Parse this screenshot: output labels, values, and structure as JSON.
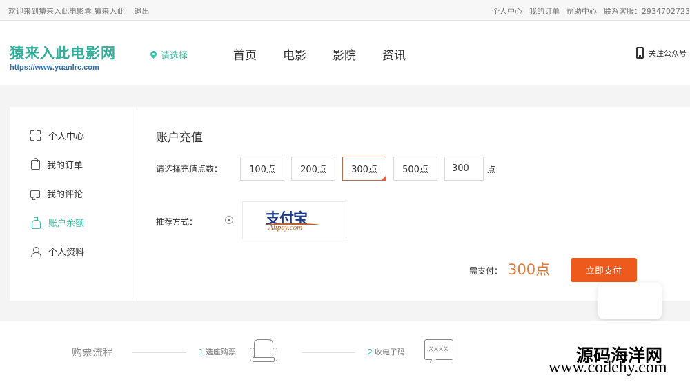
{
  "topbar": {
    "welcome": "欢迎来到猿来入此电影票 猿来入此",
    "logout": "退出",
    "links": [
      "个人中心",
      "我的订单",
      "帮助中心"
    ],
    "service": "联系客服：2934702723"
  },
  "header": {
    "logo_name": "猿来入此电影网",
    "logo_url": "https://www.yuanlrc.com",
    "city": "请选择",
    "nav": [
      "首页",
      "电影",
      "影院",
      "资讯"
    ],
    "wechat": "关注公众号"
  },
  "sidebar": {
    "items": [
      {
        "label": "个人中心",
        "icon": "grid-icon"
      },
      {
        "label": "我的订单",
        "icon": "bag-icon"
      },
      {
        "label": "我的评论",
        "icon": "comment-icon"
      },
      {
        "label": "账户余额",
        "icon": "balance-icon",
        "active": true
      },
      {
        "label": "个人资料",
        "icon": "user-icon"
      }
    ]
  },
  "recharge": {
    "title": "账户充值",
    "amount_label": "请选择充值点数：",
    "options": [
      "100点",
      "200点",
      "300点",
      "500点"
    ],
    "selected": "300点",
    "custom_value": "300",
    "unit": "点",
    "method_label": "推荐方式：",
    "alipay_cn": "支付宝",
    "alipay_en": "Alipay.com",
    "need_label": "需支付：",
    "need_value": "300点",
    "pay_button": "立即支付"
  },
  "process": {
    "title": "购票流程",
    "steps": [
      {
        "num": "1",
        "label": "选座购票"
      },
      {
        "num": "2",
        "label": "收电子码"
      }
    ],
    "code_text": "XXXX"
  },
  "watermark": {
    "line1": "源码海洋网",
    "line2": "www.codehy.com"
  },
  "colors": {
    "accent": "#3bbfa5",
    "pay": "#ee5a1c",
    "price": "#e07b3a"
  }
}
